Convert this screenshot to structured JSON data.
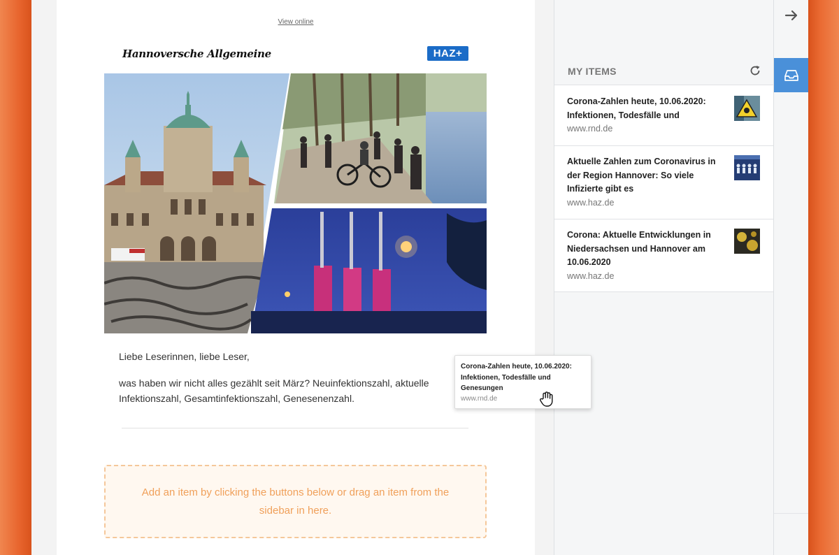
{
  "colors": {
    "accent_orange": "#e8652e",
    "sidebar_active_blue": "#4a90d9",
    "haz_blue": "#1b6cc7",
    "dropzone_text": "#f0a05a"
  },
  "email": {
    "view_online": "View online",
    "brand_logo": "Hannoversche Allgemeine",
    "badge": "HAZ+",
    "greeting": "Liebe Leserinnen, liebe Leser,",
    "body": "was haben wir nicht alles gezählt seit März? Neuinfektionszahl, aktuelle Infektionszahl, Gesamtinfektionszahl, Genesenenzahl.",
    "dropzone_text": "Add an item by clicking the buttons below or drag an item from the sidebar in here."
  },
  "sidebar": {
    "title": "MY ITEMS",
    "refresh_icon": "refresh-icon",
    "items": [
      {
        "title": "Corona-Zahlen heute, 10.06.2020: Infektionen, Todesfälle und Genesungen",
        "source": "www.rnd.de"
      },
      {
        "title": "Aktuelle Zahlen zum Coronavirus in der Region Hannover: So viele Infizierte gibt es",
        "source": "www.haz.de"
      },
      {
        "title": "Corona: Aktuelle Entwicklungen in Niedersachsen und Hannover am 10.06.2020",
        "source": "www.haz.de"
      }
    ]
  },
  "rail": {
    "collapse_icon": "arrow-right-icon",
    "inbox_icon": "inbox-icon"
  },
  "drag_preview": {
    "title": "Corona-Zahlen heute, 10.06.2020: Infektionen, Todesfälle und Genesungen",
    "source": "www.rnd.de"
  }
}
